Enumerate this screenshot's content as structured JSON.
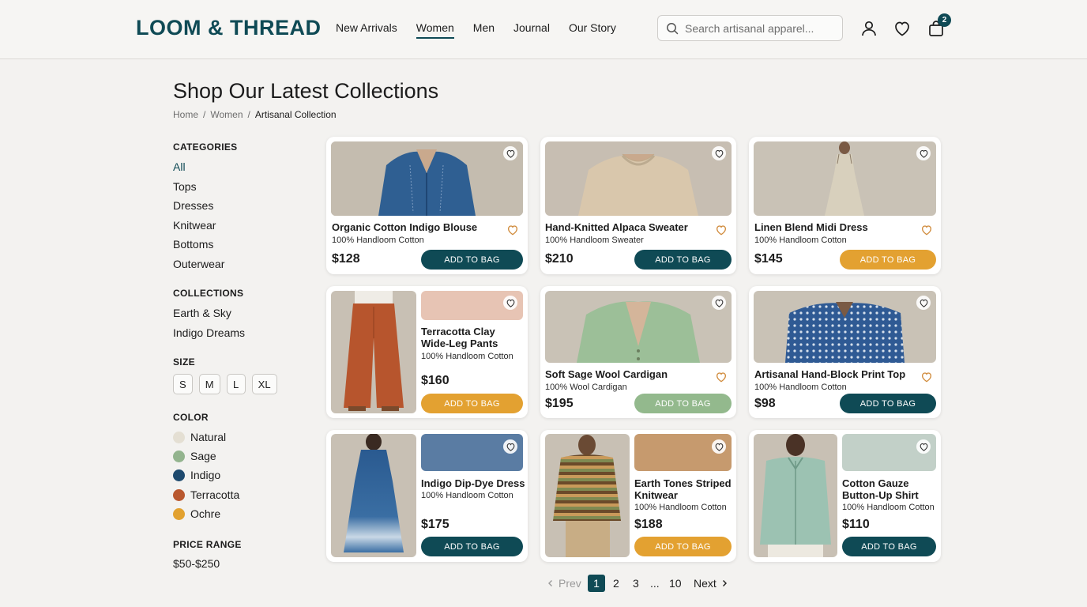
{
  "brand": "LOOM & THREAD",
  "nav": [
    "New Arrivals",
    "Women",
    "Men",
    "Journal",
    "Our Story"
  ],
  "nav_active": "Women",
  "search": {
    "placeholder": "Search artisanal apparel..."
  },
  "cart_count": "2",
  "page_title": "Shop Our Latest Collections",
  "breadcrumb": {
    "home": "Home",
    "section": "Women",
    "current": "Artisanal Collection",
    "sep": "/"
  },
  "sidebar": {
    "categories_heading": "CATEGORIES",
    "categories": [
      "All",
      "Tops",
      "Dresses",
      "Knitwear",
      "Bottoms",
      "Outerwear"
    ],
    "collections_heading": "COLLECTIONS",
    "collections": [
      "Earth & Sky",
      "Indigo Dreams"
    ],
    "size_heading": "SIZE",
    "sizes": [
      "S",
      "M",
      "L",
      "XL"
    ],
    "color_heading": "COLOR",
    "colors": [
      {
        "name": "Natural",
        "hex": "#e4dfd3"
      },
      {
        "name": "Sage",
        "hex": "#93b48e"
      },
      {
        "name": "Indigo",
        "hex": "#1e4a6e"
      },
      {
        "name": "Terracotta",
        "hex": "#b9582f"
      },
      {
        "name": "Ochre",
        "hex": "#e2a12f"
      }
    ],
    "price_heading": "PRICE RANGE",
    "price_range": "$50-$250"
  },
  "theme": {
    "accent": "#0f4a55",
    "ochre": "#e3a131",
    "sage_btn": "#93b98d"
  },
  "products": [
    {
      "name": "Organic Cotton Indigo Blouse",
      "sub": "100% Handloom Cotton",
      "price": "$128",
      "cta": "ADD TO BAG"
    },
    {
      "name": "Hand-Knitted Alpaca Sweater",
      "sub": "100% Handloom Sweater",
      "price": "$210",
      "cta": "ADD TO BAG"
    },
    {
      "name": "Linen Blend Midi Dress",
      "sub": "100% Handloom Cotton",
      "price": "$145",
      "cta": "ADD TO BAG"
    },
    {
      "name": "Terracotta Clay Wide-Leg Pants",
      "sub": "100% Handloom Cotton",
      "price": "$160",
      "cta": "ADD TO BAG"
    },
    {
      "name": "Soft Sage Wool Cardigan",
      "sub": "100% Wool Cardigan",
      "price": "$195",
      "cta": "ADD TO BAG"
    },
    {
      "name": "Artisanal Hand-Block Print Top",
      "sub": "100% Handloom Cotton",
      "price": "$98",
      "cta": "ADD TO BAG"
    },
    {
      "name": "Indigo Dip-Dye Dress",
      "sub": "100% Handloom Cotton",
      "price": "$175",
      "cta": "ADD TO BAG"
    },
    {
      "name": "Earth Tones Striped Knitwear",
      "sub": "100% Handloom Cotton",
      "price": "$188",
      "cta": "ADD TO BAG"
    },
    {
      "name": "Cotton Gauze Button-Up Shirt",
      "sub": "100% Handloom Cotton",
      "price": "$110",
      "cta": "ADD TO BAG"
    }
  ],
  "pagination": {
    "prev": "Prev",
    "pages": [
      "1",
      "2",
      "3",
      "...",
      "10"
    ],
    "next": "Next",
    "current": "1"
  }
}
